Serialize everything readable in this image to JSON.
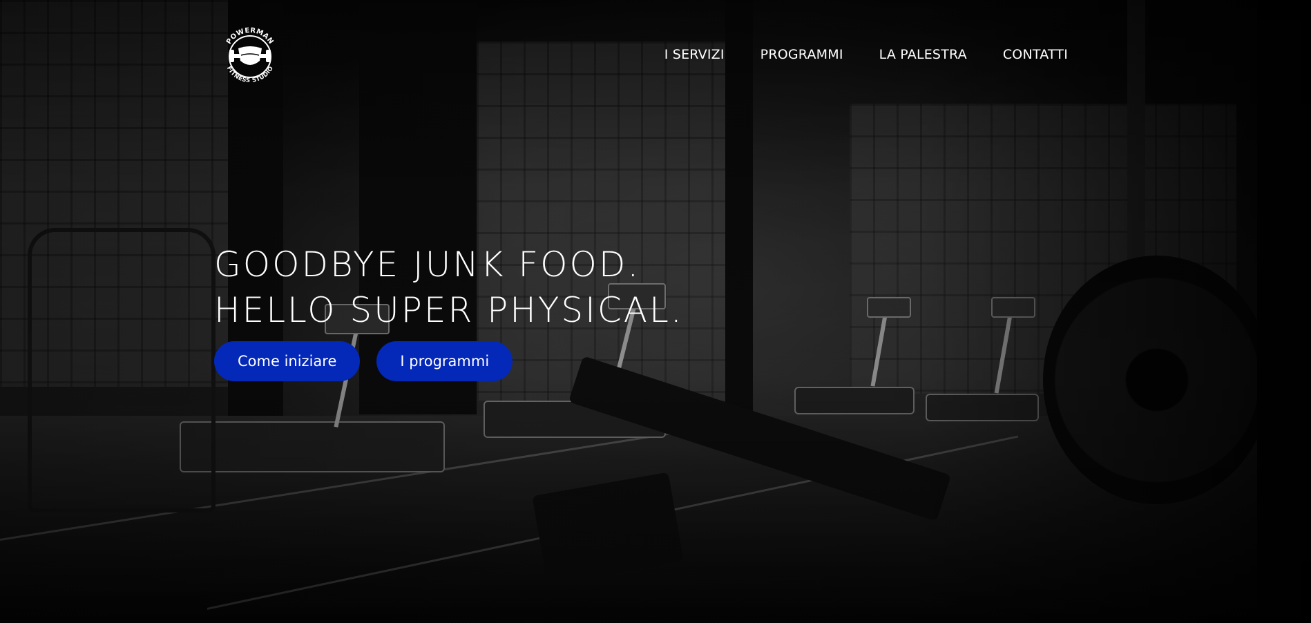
{
  "brand": {
    "logo_top_text": "POWERMAN",
    "logo_bottom_text": "FITNESS STUDIO"
  },
  "nav": {
    "items": [
      {
        "label": "I SERVIZI"
      },
      {
        "label": "PROGRAMMI"
      },
      {
        "label": "LA PALESTRA"
      },
      {
        "label": "CONTATTI"
      }
    ]
  },
  "hero": {
    "headline_line1": "GOODBYE JUNK FOOD.",
    "headline_line2": "HELLO SUPER PHYSICAL.",
    "cta_primary": "Come iniziare",
    "cta_secondary": "I programmi",
    "background_image": "black-and-white gym interior with treadmills and weight bench"
  },
  "colors": {
    "button_bg": "#0428b8",
    "text": "#ffffff",
    "background": "#000000"
  },
  "icons": {
    "logo": "shield-barbell-logo-icon"
  }
}
